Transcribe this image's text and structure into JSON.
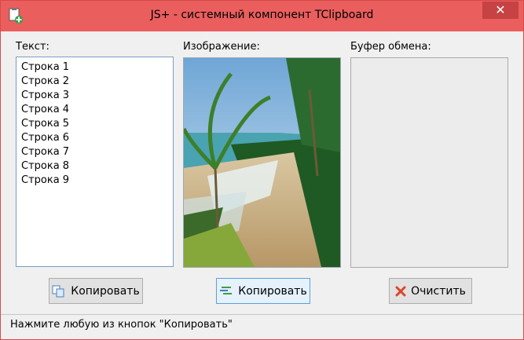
{
  "window": {
    "title": "JS+ - системный компонент TClipboard",
    "close_glyph": "✕"
  },
  "labels": {
    "text": "Текст:",
    "image": "Изображение:",
    "clipboard": "Буфер обмена:"
  },
  "list": {
    "items": [
      "Строка 1",
      "Строка 2",
      "Строка 3",
      "Строка 4",
      "Строка 5",
      "Строка 6",
      "Строка 7",
      "Строка 8",
      "Строка 9"
    ]
  },
  "buttons": {
    "copy_text": "Копировать",
    "copy_image": "Копировать",
    "clear": "Очистить"
  },
  "status": {
    "text": "Нажмите любую из кнопок \"Копировать\""
  },
  "colors": {
    "titlebar": "#ea5e5e",
    "close": "#c74242",
    "accent": "#5fa0d8"
  },
  "icons": {
    "app": "clipboard-add-icon",
    "copy_text": "copy-docs-icon",
    "copy_image": "copy-lines-icon",
    "clear": "red-x-icon"
  }
}
